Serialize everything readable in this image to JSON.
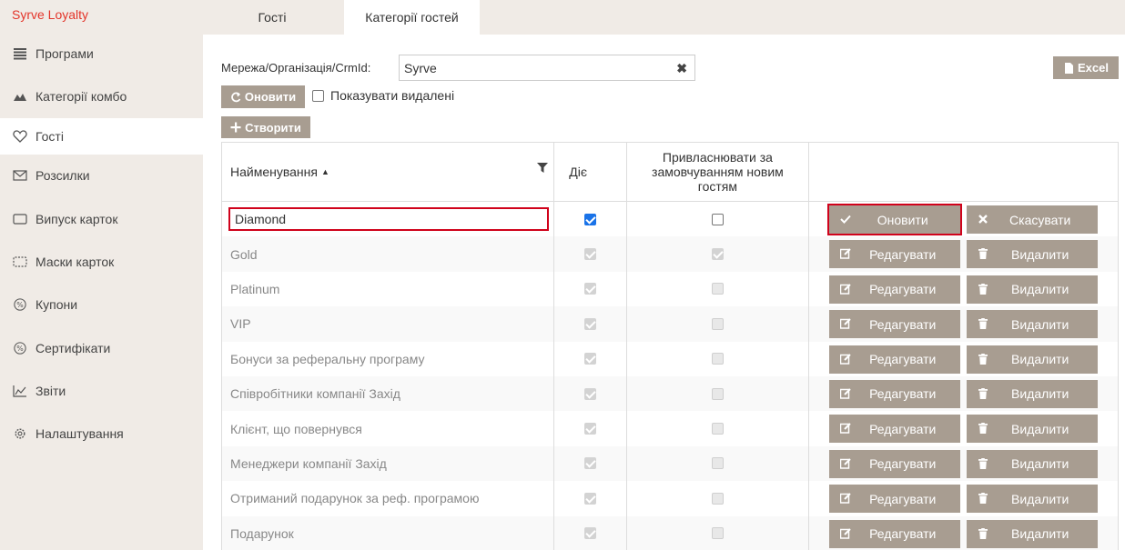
{
  "sidebar": {
    "brand": "Syrve Loyalty",
    "items": [
      {
        "label": "Програми",
        "icon": "list-icon"
      },
      {
        "label": "Категорії комбо",
        "icon": "combo-icon"
      },
      {
        "label": "Гості",
        "icon": "heart-icon",
        "active": true
      },
      {
        "label": "Розсилки",
        "icon": "envelope-icon"
      },
      {
        "label": "Випуск карток",
        "icon": "card-icon"
      },
      {
        "label": "Маски карток",
        "icon": "card-mask-icon"
      },
      {
        "label": "Купони",
        "icon": "percent-icon"
      },
      {
        "label": "Сертифікати",
        "icon": "percent-icon"
      },
      {
        "label": "Звіти",
        "icon": "chart-icon"
      },
      {
        "label": "Налаштування",
        "icon": "gear-icon"
      }
    ]
  },
  "tabs": [
    {
      "label": "Гості"
    },
    {
      "label": "Категорії гостей",
      "active": true
    }
  ],
  "filter": {
    "label": "Мережа/Організація/CrmId:",
    "value": "Syrve",
    "refresh_label": "Оновити",
    "show_deleted_label": "Показувати видалені",
    "create_label": "Створити",
    "excel_label": "Excel"
  },
  "table": {
    "headers": {
      "name": "Найменування",
      "active": "Діє",
      "assign_default": "Привласнювати за замовчуванням новим гостям"
    },
    "actions": {
      "update": "Оновити",
      "cancel": "Скасувати",
      "edit": "Редагувати",
      "delete": "Видалити"
    },
    "rows": [
      {
        "name": "Diamond",
        "active": true,
        "default": false,
        "editing": true
      },
      {
        "name": "Gold",
        "active": true,
        "default": true
      },
      {
        "name": "Platinum",
        "active": true,
        "default": false
      },
      {
        "name": "VIP",
        "active": true,
        "default": false
      },
      {
        "name": "Бонуси за реферальну програму",
        "active": true,
        "default": false
      },
      {
        "name": "Співробітники компанії Захід",
        "active": true,
        "default": false
      },
      {
        "name": "Клієнт, що повернувся",
        "active": true,
        "default": false
      },
      {
        "name": "Менеджери компанії Захід",
        "active": true,
        "default": false
      },
      {
        "name": "Отриманий подарунок за реф. програмою",
        "active": true,
        "default": false
      },
      {
        "name": "Подарунок",
        "active": true,
        "default": false
      }
    ]
  },
  "colors": {
    "brand": "#e3352a",
    "button": "#a89d91",
    "highlight": "#d0021b",
    "sidebar_bg": "#f0ebe6"
  }
}
